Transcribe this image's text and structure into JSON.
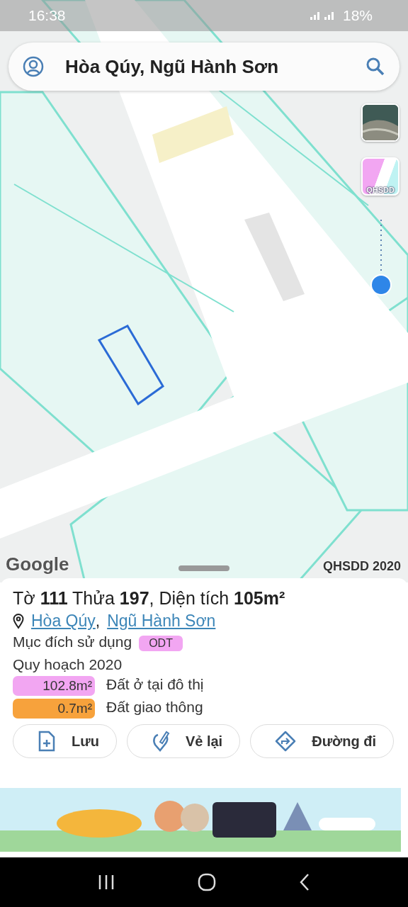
{
  "status_bar": {
    "time": "16:38",
    "battery": "18%"
  },
  "search": {
    "value": "Hòa Qúy, Ngũ Hành Sơn"
  },
  "layers": [
    {
      "kind": "satellite"
    },
    {
      "kind": "planning",
      "label": "QHSDD"
    }
  ],
  "map": {
    "logo": "Google",
    "overlay_label": "QHSDD 2020"
  },
  "parcel": {
    "title": "Tờ **111** Thửa **197**, Diện tích **105m²**",
    "places": [
      "Hòa Qúy",
      "Ngũ Hành Sơn"
    ],
    "separator": ",",
    "purpose_label": "Mục đích sử dụng",
    "purpose_code": "ODT",
    "plan_title": "Quy hoạch 2020",
    "uses": [
      {
        "area": "102.8m²",
        "name": "Đất ở tại đô thị",
        "color": "#f2a6f2"
      },
      {
        "area": "0.7m²",
        "name": "Đất giao thông",
        "color": "#f7a23c"
      }
    ],
    "actions": [
      {
        "kind": "save",
        "label": "Lưu"
      },
      {
        "kind": "redraw",
        "label": "Vẻ lại"
      },
      {
        "kind": "directions",
        "label": "Đường đi"
      }
    ]
  }
}
